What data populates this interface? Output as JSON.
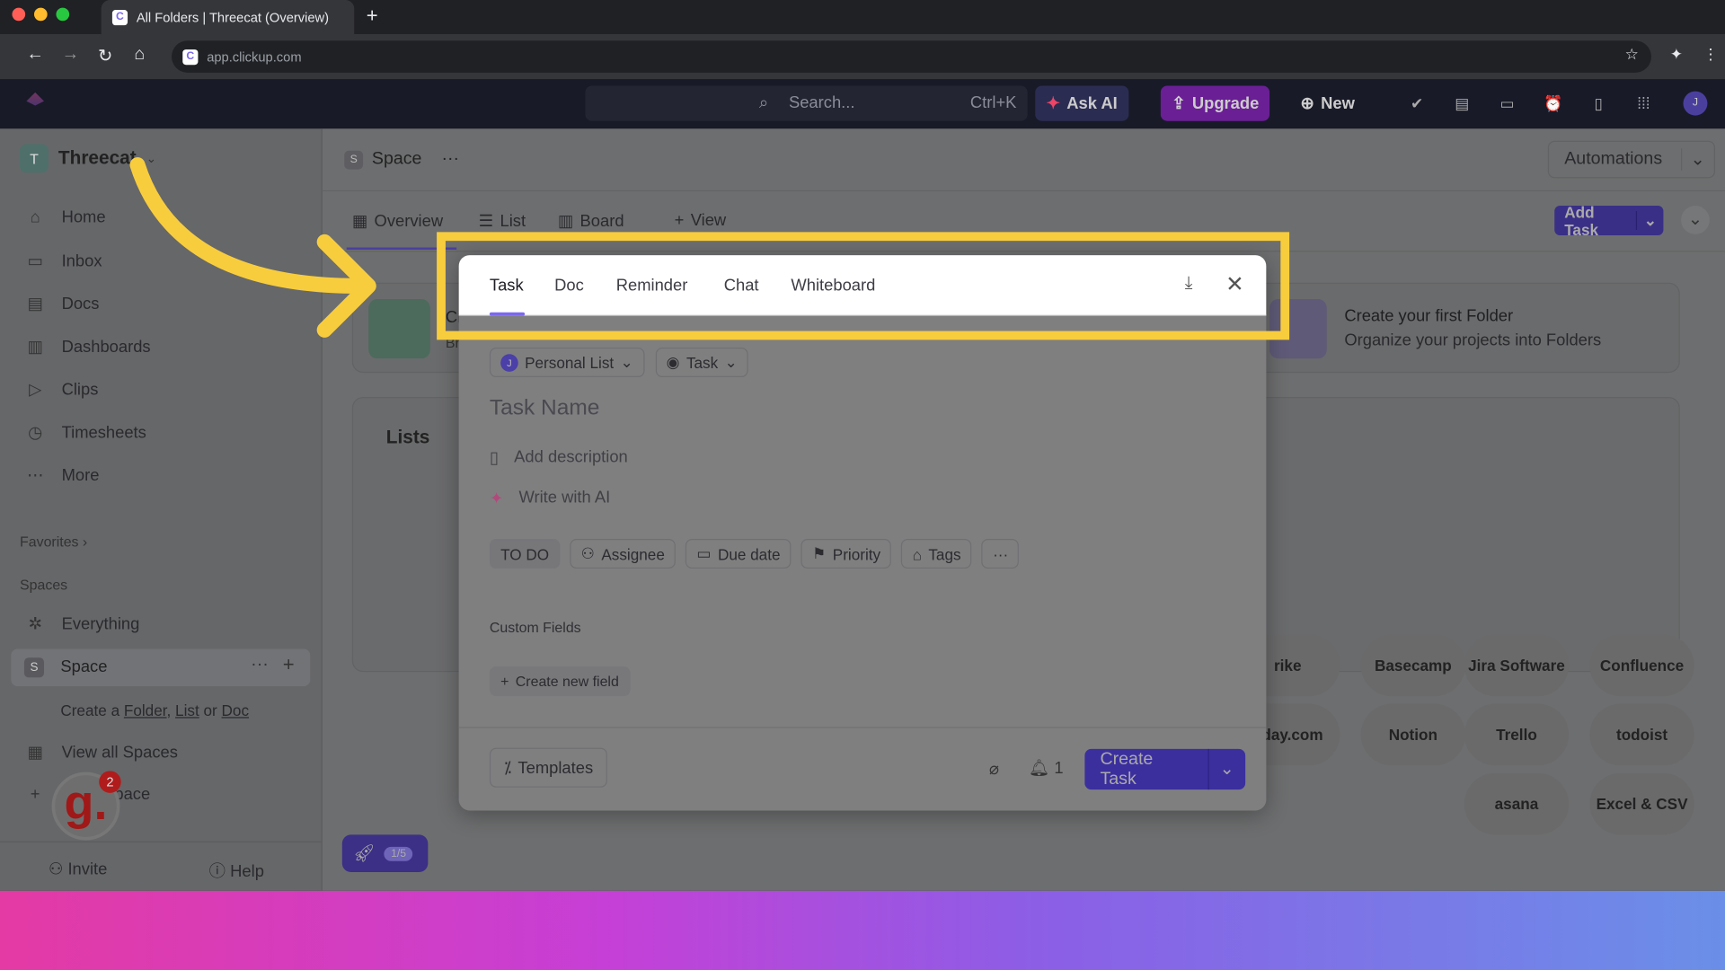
{
  "browser": {
    "tab_title": "All Folders | Threecat (Overview)",
    "url": "app.clickup.com"
  },
  "topbar": {
    "search_placeholder": "Search...",
    "search_shortcut": "Ctrl+K",
    "ask_ai": "Ask AI",
    "upgrade": "Upgrade",
    "new": "New",
    "avatar": "J"
  },
  "sidebar": {
    "workspace_initial": "T",
    "workspace": "Threecat",
    "items": [
      {
        "label": "Home",
        "icon": "home-icon"
      },
      {
        "label": "Inbox",
        "icon": "inbox-icon"
      },
      {
        "label": "Docs",
        "icon": "docs-icon"
      },
      {
        "label": "Dashboards",
        "icon": "dashboards-icon"
      },
      {
        "label": "Clips",
        "icon": "clips-icon"
      },
      {
        "label": "Timesheets",
        "icon": "timesheets-icon"
      },
      {
        "label": "More",
        "icon": "more-icon"
      }
    ],
    "favorites": "Favorites",
    "spaces": "Spaces",
    "everything": "Everything",
    "space_initial": "S",
    "space": "Space",
    "create_prefix": "Create a",
    "folder": "Folder",
    "list": "List",
    "or": "or",
    "doc": "Doc",
    "view_all": "View all Spaces",
    "new_space": "Space",
    "invite": "Invite",
    "help": "Help",
    "badge_count": "2"
  },
  "main": {
    "space_initial": "S",
    "space": "Space",
    "automations": "Automations",
    "tabs": [
      "Overview",
      "List",
      "Board",
      "View"
    ],
    "add_task": "Add Task",
    "folder_title": "Create your first Folder",
    "folder_sub": "Organize your projects into Folders",
    "lists": "Lists",
    "card_left_partial": "Cr",
    "card_left_partial2": "Br",
    "onboarding": "1/5",
    "integrations": [
      "rike",
      "Basecamp",
      "Jira Software",
      "Confluence",
      "nday.com",
      "Notion",
      "Trello",
      "todoist",
      "asana",
      "Excel & CSV"
    ]
  },
  "modal": {
    "tabs": [
      "Task",
      "Doc",
      "Reminder",
      "Chat",
      "Whiteboard"
    ],
    "active_tab": "Task",
    "list_initial": "J",
    "list": "Personal List",
    "type": "Task",
    "task_name_placeholder": "Task Name",
    "description": "Add description",
    "write_ai": "Write with AI",
    "status": "TO DO",
    "assignee": "Assignee",
    "due": "Due date",
    "priority": "Priority",
    "tags": "Tags",
    "custom_fields": "Custom Fields",
    "create_field": "Create new field",
    "templates": "Templates",
    "notify_count": "1",
    "create": "Create Task"
  },
  "colors": {
    "highlight": "#f8cd3d",
    "accent": "#7b68ee",
    "create_button": "#3b2f9e",
    "upgrade": "#7b1fa2"
  }
}
